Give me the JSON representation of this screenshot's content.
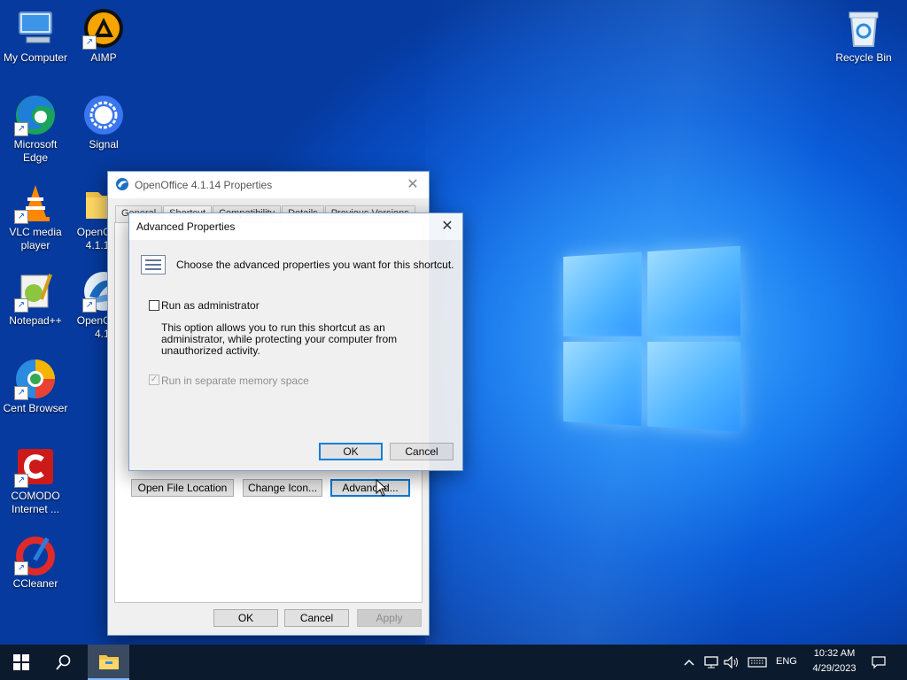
{
  "desktop": {
    "icons": [
      {
        "label": "My Computer",
        "icon": "computer-icon"
      },
      {
        "label": "AIMP",
        "icon": "aimp-icon"
      },
      {
        "label": "Recycle Bin",
        "icon": "recycle-bin-icon"
      },
      {
        "label": "Microsoft Edge",
        "icon": "edge-icon"
      },
      {
        "label": "Signal",
        "icon": "signal-icon"
      },
      {
        "label": "VLC media player",
        "icon": "vlc-icon"
      },
      {
        "label": "OpenOffice 4.1.14 (",
        "icon": "folder-icon"
      },
      {
        "label": "Notepad++",
        "icon": "notepadpp-icon"
      },
      {
        "label": "OpenOffice 4.1.",
        "icon": "openoffice-icon"
      },
      {
        "label": "Cent Browser",
        "icon": "cent-browser-icon"
      },
      {
        "label": "COMODO Internet ...",
        "icon": "comodo-icon"
      },
      {
        "label": "CCleaner",
        "icon": "ccleaner-icon"
      }
    ]
  },
  "properties_dialog": {
    "title": "OpenOffice 4.1.14 Properties",
    "tabs": [
      "General",
      "Shortcut",
      "Compatibility",
      "Details",
      "Previous Versions"
    ],
    "active_tab": "Shortcut",
    "buttons": {
      "open_file_location": "Open File Location",
      "change_icon": "Change Icon...",
      "advanced": "Advanced...",
      "ok": "OK",
      "cancel": "Cancel",
      "apply": "Apply"
    }
  },
  "advanced_dialog": {
    "title": "Advanced Properties",
    "header": "Choose the advanced properties you want for this shortcut.",
    "run_as_admin": {
      "label": "Run as administrator",
      "checked": false
    },
    "description_lines": [
      "This option allows you to run this shortcut as an",
      "administrator, while protecting your computer from",
      "unauthorized activity."
    ],
    "separate_memory": {
      "label": "Run in separate memory space",
      "checked": true,
      "disabled": true
    },
    "ok": "OK",
    "cancel": "Cancel"
  },
  "taskbar": {
    "language": "ENG",
    "time": "10:32 AM",
    "date": "4/29/2023"
  },
  "colors": {
    "accent": "#0078d7",
    "taskbar": "#0c1a2d"
  }
}
